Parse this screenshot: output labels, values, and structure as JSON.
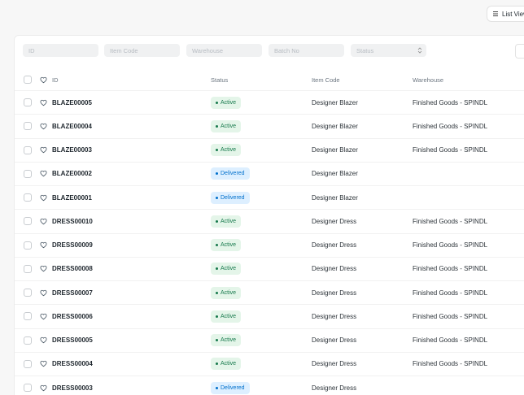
{
  "toolbar": {
    "view_label": "List View"
  },
  "filters": [
    {
      "placeholder": "ID"
    },
    {
      "placeholder": "Item Code"
    },
    {
      "placeholder": "Warehouse"
    },
    {
      "placeholder": "Batch No"
    },
    {
      "placeholder": "Status"
    }
  ],
  "table": {
    "columns": [
      "ID",
      "Status",
      "Item Code",
      "Warehouse"
    ],
    "rows": [
      {
        "id": "BLAZE00005",
        "status": "Active",
        "item_code": "Designer Blazer",
        "warehouse": "Finished Goods - SPINDL"
      },
      {
        "id": "BLAZE00004",
        "status": "Active",
        "item_code": "Designer Blazer",
        "warehouse": "Finished Goods - SPINDL"
      },
      {
        "id": "BLAZE00003",
        "status": "Active",
        "item_code": "Designer Blazer",
        "warehouse": "Finished Goods - SPINDL"
      },
      {
        "id": "BLAZE00002",
        "status": "Delivered",
        "item_code": "Designer Blazer",
        "warehouse": ""
      },
      {
        "id": "BLAZE00001",
        "status": "Delivered",
        "item_code": "Designer Blazer",
        "warehouse": ""
      },
      {
        "id": "DRESS00010",
        "status": "Active",
        "item_code": "Designer Dress",
        "warehouse": "Finished Goods - SPINDL"
      },
      {
        "id": "DRESS00009",
        "status": "Active",
        "item_code": "Designer Dress",
        "warehouse": "Finished Goods - SPINDL"
      },
      {
        "id": "DRESS00008",
        "status": "Active",
        "item_code": "Designer Dress",
        "warehouse": "Finished Goods - SPINDL"
      },
      {
        "id": "DRESS00007",
        "status": "Active",
        "item_code": "Designer Dress",
        "warehouse": "Finished Goods - SPINDL"
      },
      {
        "id": "DRESS00006",
        "status": "Active",
        "item_code": "Designer Dress",
        "warehouse": "Finished Goods - SPINDL"
      },
      {
        "id": "DRESS00005",
        "status": "Active",
        "item_code": "Designer Dress",
        "warehouse": "Finished Goods - SPINDL"
      },
      {
        "id": "DRESS00004",
        "status": "Active",
        "item_code": "Designer Dress",
        "warehouse": "Finished Goods - SPINDL"
      },
      {
        "id": "DRESS00003",
        "status": "Delivered",
        "item_code": "Designer Dress",
        "warehouse": ""
      }
    ]
  },
  "colors": {
    "active_bg": "#e4f5e9",
    "active_fg": "#16794c",
    "delivered_bg": "#ddefff",
    "delivered_fg": "#0070cc"
  }
}
